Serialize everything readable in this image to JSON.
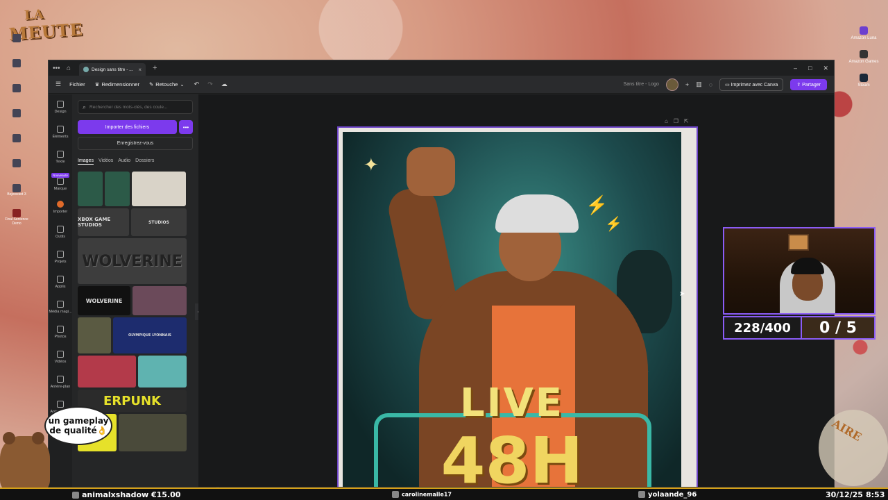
{
  "desktop": {
    "left_icons": [
      "",
      "",
      "",
      "",
      "",
      "",
      "Bejeweled 3",
      "Final Sentence Demo"
    ],
    "right_icons": [
      "Amazon Luna",
      "Amazon Games",
      "Steam"
    ],
    "logo_top": "LA",
    "logo_bottom": "MEUTE"
  },
  "browser": {
    "tab_title": "Design sans titre - ...",
    "new_tab": "+",
    "window_controls": [
      "–",
      "□",
      "✕"
    ]
  },
  "toolbar": {
    "menu": "Fichier",
    "resize": "Redimensionner",
    "edit": "Retouche",
    "doc_title": "Sans titre - Logo",
    "print": "Imprimez avec Canva",
    "share": "Partager"
  },
  "rail": [
    {
      "label": "Design",
      "badge": ""
    },
    {
      "label": "Éléments",
      "badge": ""
    },
    {
      "label": "Texte",
      "badge": ""
    },
    {
      "label": "Marque",
      "badge": "Nouveauté"
    },
    {
      "label": "Importer",
      "badge": ""
    },
    {
      "label": "Outils",
      "badge": ""
    },
    {
      "label": "Projets",
      "badge": ""
    },
    {
      "label": "Applis",
      "badge": ""
    },
    {
      "label": "Média magi...",
      "badge": ""
    },
    {
      "label": "Photos",
      "badge": ""
    },
    {
      "label": "Vidéos",
      "badge": ""
    },
    {
      "label": "Arrière-plan",
      "badge": ""
    },
    {
      "label": "Anime Style",
      "badge": ""
    }
  ],
  "panel": {
    "search_placeholder": "Rechercher des mots-clés, des coule...",
    "upload": "Importer des fichiers",
    "more": "•••",
    "record": "Enregistrez-vous",
    "tabs": [
      "Images",
      "Vidéos",
      "Audio",
      "Dossiers"
    ],
    "thumbs": [
      "",
      "",
      "",
      "XBOX GAME STUDIOS",
      "STUDIOS",
      "WOLVERINE",
      "WOLVERINE",
      "",
      "",
      "OLYMPIQUE LYONNAIS",
      "",
      "",
      "ERPUNK",
      "",
      ""
    ]
  },
  "poster": {
    "line1": "LIVE",
    "line2": "48H"
  },
  "overlay": {
    "counter_left": "228/400",
    "counter_right": "0 / 5",
    "bubble_line1": "un gameplay",
    "bubble_line2": "de qualité👌",
    "right_deco": "AIRE"
  },
  "ticker": {
    "donor": "animalxshadow €15.00",
    "follower": "carolinemalle17",
    "sub": "yolaande_96",
    "date": "30/12/25",
    "time": "8:53"
  },
  "colors": {
    "accent": "#7c3aed",
    "ticker_border": "#d4a017"
  }
}
